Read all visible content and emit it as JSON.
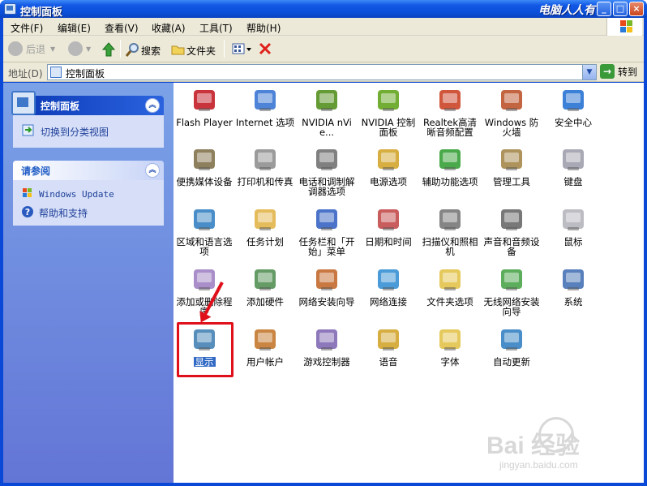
{
  "window": {
    "title": "控制面板",
    "watermark": "电脑人人有",
    "buttons": [
      "_",
      "□",
      "×"
    ]
  },
  "menu": [
    "文件(F)",
    "编辑(E)",
    "查看(V)",
    "收藏(A)",
    "工具(T)",
    "帮助(H)"
  ],
  "toolbar": {
    "back": "后退",
    "search": "搜索",
    "folders": "文件夹"
  },
  "address": {
    "label": "地址(D)",
    "value": "控制面板",
    "go": "转到"
  },
  "sidebar": {
    "cp_title": "控制面板",
    "switch_view": "切换到分类视图",
    "see_also_title": "请参阅",
    "links": [
      "Windows Update",
      "帮助和支持"
    ]
  },
  "icons": [
    {
      "label": "Flash Player",
      "icon": "flash-icon",
      "color": "#c0101a"
    },
    {
      "label": "Internet 选项",
      "icon": "internet-options-icon",
      "color": "#2f6fd0"
    },
    {
      "label": "NVIDIA nVie...",
      "icon": "nvidia-nview-icon",
      "color": "#4a8a10"
    },
    {
      "label": "NVIDIA 控制面板",
      "icon": "nvidia-control-icon",
      "color": "#5aa010"
    },
    {
      "label": "Realtek高清晰音频配置",
      "icon": "realtek-audio-icon",
      "color": "#c83a1a"
    },
    {
      "label": "Windows 防火墙",
      "icon": "firewall-icon",
      "color": "#b84a20"
    },
    {
      "label": "安全中心",
      "icon": "security-center-icon",
      "color": "#1a6ad0"
    },
    {
      "label": "便携媒体设备",
      "icon": "portable-media-icon",
      "color": "#7a6a40"
    },
    {
      "label": "打印机和传真",
      "icon": "printer-icon",
      "color": "#8a8a8a"
    },
    {
      "label": "电话和调制解调器选项",
      "icon": "phone-modem-icon",
      "color": "#6a6a6a"
    },
    {
      "label": "电源选项",
      "icon": "power-options-icon",
      "color": "#d0a020"
    },
    {
      "label": "辅助功能选项",
      "icon": "accessibility-icon",
      "color": "#2a9a2a"
    },
    {
      "label": "管理工具",
      "icon": "admin-tools-icon",
      "color": "#a08040"
    },
    {
      "label": "键盘",
      "icon": "keyboard-icon",
      "color": "#9a9aa8"
    },
    {
      "label": "区域和语言选项",
      "icon": "region-language-icon",
      "color": "#2a7ac0"
    },
    {
      "label": "任务计划",
      "icon": "scheduled-tasks-icon",
      "color": "#e0b040"
    },
    {
      "label": "任务栏和「开始」菜单",
      "icon": "taskbar-icon",
      "color": "#2a5ac0"
    },
    {
      "label": "日期和时间",
      "icon": "date-time-icon",
      "color": "#c04040"
    },
    {
      "label": "扫描仪和照相机",
      "icon": "scanner-camera-icon",
      "color": "#707070"
    },
    {
      "label": "声音和音频设备",
      "icon": "sound-icon",
      "color": "#606060"
    },
    {
      "label": "鼠标",
      "icon": "mouse-icon",
      "color": "#b0b0b8"
    },
    {
      "label": "添加或删除程序",
      "icon": "add-remove-icon",
      "color": "#9a7ac0"
    },
    {
      "label": "添加硬件",
      "icon": "add-hardware-icon",
      "color": "#4a8a4a"
    },
    {
      "label": "网络安装向导",
      "icon": "network-setup-icon",
      "color": "#c06020"
    },
    {
      "label": "网络连接",
      "icon": "network-connections-icon",
      "color": "#2a8ad0"
    },
    {
      "label": "文件夹选项",
      "icon": "folder-options-icon",
      "color": "#e0c040"
    },
    {
      "label": "无线网络安装向导",
      "icon": "wireless-icon",
      "color": "#40a040"
    },
    {
      "label": "系统",
      "icon": "system-icon",
      "color": "#3a6ab0"
    },
    {
      "label": "显示",
      "icon": "display-icon",
      "color": "#3a7ab0",
      "selected": true
    },
    {
      "label": "用户帐户",
      "icon": "user-accounts-icon",
      "color": "#c07020"
    },
    {
      "label": "游戏控制器",
      "icon": "game-controller-icon",
      "color": "#7a60b0"
    },
    {
      "label": "语音",
      "icon": "speech-icon",
      "color": "#d0a020"
    },
    {
      "label": "字体",
      "icon": "fonts-icon",
      "color": "#e0c040"
    },
    {
      "label": "自动更新",
      "icon": "auto-update-icon",
      "color": "#2a7ac0"
    }
  ],
  "watermark_baidu": {
    "logo": "Bai 经验",
    "url": "jingyan.baidu.com"
  }
}
